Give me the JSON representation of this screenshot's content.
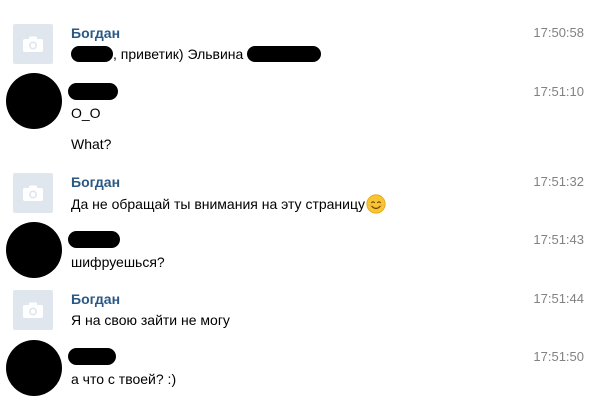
{
  "messages": [
    {
      "author": "Богдан",
      "time": "17:50:58",
      "text_middle": ", приветик) Эльвина",
      "avatar": "camera-placeholder"
    },
    {
      "author": "",
      "time": "17:51:10",
      "text_lines": [
        "O_O",
        "What?"
      ],
      "avatar": "redacted"
    },
    {
      "author": "Богдан",
      "time": "17:51:32",
      "text": "Да не обращай ты внимания на эту страницу",
      "emoji": "smiling-face-emoji",
      "avatar": "camera-placeholder"
    },
    {
      "author": "",
      "time": "17:51:43",
      "text": "шифруешься?",
      "avatar": "redacted"
    },
    {
      "author": "Богдан",
      "time": "17:51:44",
      "text": "Я на свою зайти не могу",
      "avatar": "camera-placeholder"
    },
    {
      "author": "",
      "time": "17:51:50",
      "text": "а что с твоей? :)",
      "avatar": "redacted"
    }
  ],
  "colors": {
    "author_link": "#2a5885",
    "timestamp": "#828282",
    "avatar_placeholder_bg": "#dfe6ee",
    "avatar_placeholder_icon": "#ffffff",
    "redaction": "#000000"
  }
}
